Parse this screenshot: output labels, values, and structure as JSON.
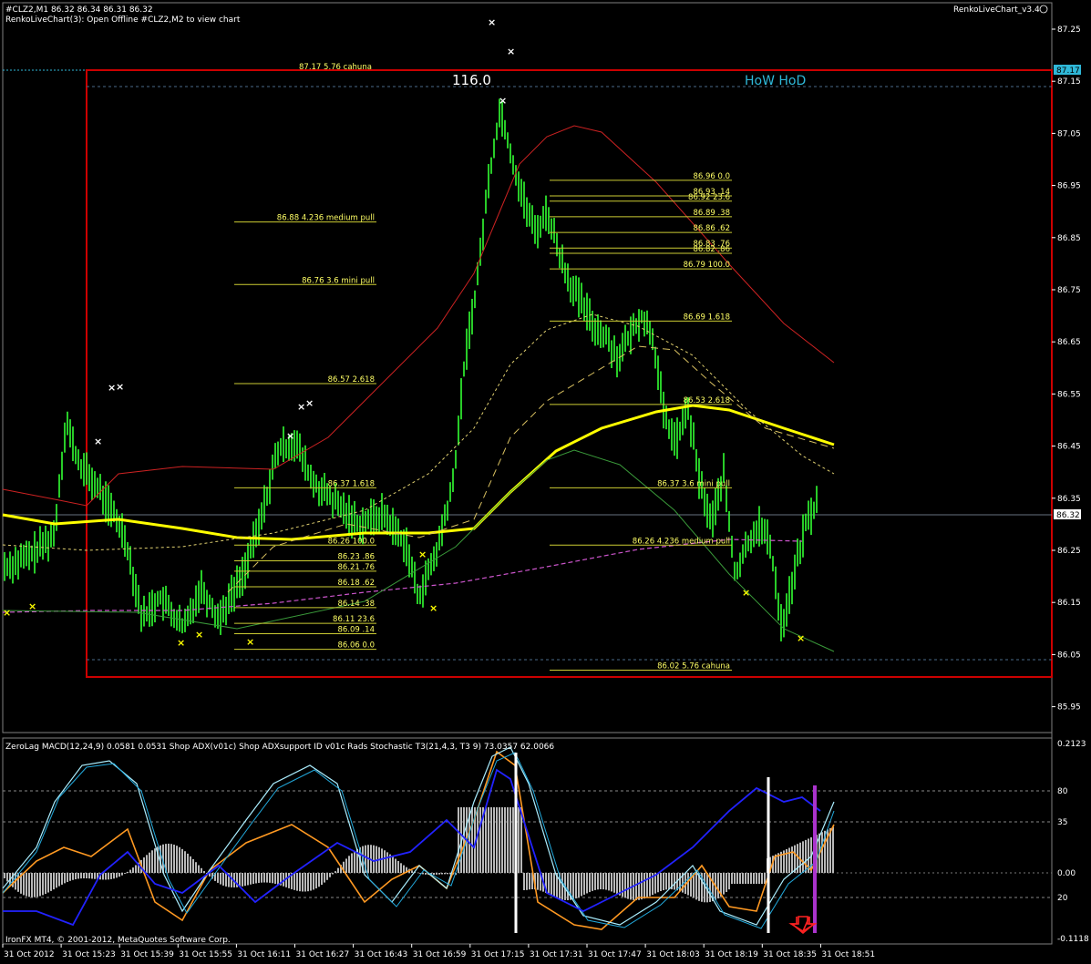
{
  "header": {
    "line1": "#CLZ2,M1  86.32 86.34 86.31 86.32",
    "line2": "RenkoLiveChart(3): Open Offline #CLZ2,M2 to view chart",
    "right_label": "RenkoLiveChart_v3.4"
  },
  "overlay": {
    "top_label": "116.0",
    "how_hod": "HoW HoD",
    "cahuna_top": "87.17  5.76  cahuna"
  },
  "price_axis": {
    "ticks": [
      "87.25",
      "87.15",
      "87.05",
      "86.95",
      "86.85",
      "86.75",
      "86.65",
      "86.55",
      "86.45",
      "86.35",
      "86.25",
      "86.15",
      "86.05",
      "85.95"
    ],
    "tick_values": [
      87.25,
      87.15,
      87.05,
      86.95,
      86.85,
      86.75,
      86.65,
      86.55,
      86.45,
      86.35,
      86.25,
      86.15,
      86.05,
      85.95
    ],
    "hod_badge": "87.17",
    "current_badge": "86.32"
  },
  "fib_labels": [
    {
      "text": "86.88  4.236 medium pull",
      "price": 86.88
    },
    {
      "text": "86.76  3.6   mini pull",
      "price": 86.76
    },
    {
      "text": "86.57  2.618",
      "price": 86.57
    },
    {
      "text": "86.37  1.618",
      "price": 86.37
    },
    {
      "text": "86.26  100.0",
      "price": 86.26
    },
    {
      "text": "86.23  .86",
      "price": 86.23
    },
    {
      "text": "86.21  .76",
      "price": 86.21
    },
    {
      "text": "86.18  .62",
      "price": 86.18
    },
    {
      "text": "86.14  .38",
      "price": 86.14
    },
    {
      "text": "86.11  23.6",
      "price": 86.11
    },
    {
      "text": "86.09  .14",
      "price": 86.09
    },
    {
      "text": "86.06  0.0",
      "price": 86.06
    },
    {
      "text": "86.96  0.0",
      "price": 86.96
    },
    {
      "text": "86.93  .14",
      "price": 86.93
    },
    {
      "text": "86.92  23.6",
      "price": 86.92
    },
    {
      "text": "86.89  .38",
      "price": 86.89
    },
    {
      "text": "86.86  .62",
      "price": 86.86
    },
    {
      "text": "86.83  .76",
      "price": 86.83
    },
    {
      "text": "86.82  .86",
      "price": 86.82
    },
    {
      "text": "86.79  100.0",
      "price": 86.79
    },
    {
      "text": "86.69  1.618",
      "price": 86.69
    },
    {
      "text": "86.53  2.618",
      "price": 86.53
    },
    {
      "text": "86.37  3.6   mini pull",
      "price": 86.37
    },
    {
      "text": "86.26  4.236 medium pull",
      "price": 86.26
    },
    {
      "text": "86.02  5.76  cahuna",
      "price": 86.02
    }
  ],
  "indicator": {
    "label": "ZeroLag MACD(12,24,9) 0.0581 0.0531  Shop ADX(v01c)  Shop ADXsupport ID v01c  Rads Stochastic T3(21,4,3, T3 9) 73.0357 62.0066",
    "axis_ticks": [
      "0.2123",
      "80",
      "35",
      "0.00",
      "20",
      "-0.1118"
    ],
    "copyright": "IronFX MT4, © 2001-2012, MetaQuotes Software Corp."
  },
  "time_axis": [
    "31 Oct 2012",
    "31 Oct 15:23",
    "31 Oct 15:39",
    "31 Oct 15:55",
    "31 Oct 16:11",
    "31 Oct 16:27",
    "31 Oct 16:43",
    "31 Oct 16:59",
    "31 Oct 17:15",
    "31 Oct 17:31",
    "31 Oct 17:47",
    "31 Oct 18:03",
    "31 Oct 18:19",
    "31 Oct 18:35",
    "31 Oct 18:51"
  ],
  "chart_data": {
    "type": "line",
    "title": "#CLZ2,M1  86.32 86.34 86.31 86.32",
    "xlabel": "",
    "ylabel": "",
    "ylim": [
      85.92,
      87.28
    ],
    "x": [
      "31 Oct 2012",
      "31 Oct 15:23",
      "31 Oct 15:39",
      "31 Oct 15:55",
      "31 Oct 16:11",
      "31 Oct 16:27",
      "31 Oct 16:43",
      "31 Oct 16:59",
      "31 Oct 17:15",
      "31 Oct 17:31",
      "31 Oct 17:47",
      "31 Oct 18:03",
      "31 Oct 18:19",
      "31 Oct 18:35",
      "31 Oct 18:51"
    ],
    "price_path": [
      [
        0,
        86.22
      ],
      [
        0.4,
        86.24
      ],
      [
        0.8,
        86.28
      ],
      [
        1.0,
        86.5
      ],
      [
        1.2,
        86.42
      ],
      [
        1.6,
        86.36
      ],
      [
        2.0,
        86.28
      ],
      [
        2.3,
        86.12
      ],
      [
        2.6,
        86.16
      ],
      [
        3.0,
        86.1
      ],
      [
        3.3,
        86.18
      ],
      [
        3.6,
        86.12
      ],
      [
        4.0,
        86.2
      ],
      [
        4.3,
        86.3
      ],
      [
        4.6,
        86.44
      ],
      [
        4.9,
        86.46
      ],
      [
        5.2,
        86.38
      ],
      [
        5.6,
        86.34
      ],
      [
        6.0,
        86.3
      ],
      [
        6.4,
        86.32
      ],
      [
        6.8,
        86.26
      ],
      [
        7.0,
        86.16
      ],
      [
        7.3,
        86.24
      ],
      [
        7.6,
        86.38
      ],
      [
        7.8,
        86.62
      ],
      [
        8.0,
        86.76
      ],
      [
        8.2,
        86.96
      ],
      [
        8.4,
        87.1
      ],
      [
        8.6,
        87.0
      ],
      [
        8.8,
        86.92
      ],
      [
        9.0,
        86.86
      ],
      [
        9.2,
        86.9
      ],
      [
        9.4,
        86.82
      ],
      [
        9.6,
        86.76
      ],
      [
        9.8,
        86.72
      ],
      [
        10.0,
        86.68
      ],
      [
        10.2,
        86.66
      ],
      [
        10.4,
        86.62
      ],
      [
        10.6,
        86.66
      ],
      [
        10.8,
        86.7
      ],
      [
        11.0,
        86.66
      ],
      [
        11.2,
        86.5
      ],
      [
        11.4,
        86.46
      ],
      [
        11.6,
        86.52
      ],
      [
        11.8,
        86.38
      ],
      [
        12.0,
        86.3
      ],
      [
        12.2,
        86.4
      ],
      [
        12.4,
        86.2
      ],
      [
        12.6,
        86.26
      ],
      [
        12.8,
        86.3
      ],
      [
        13.0,
        86.26
      ],
      [
        13.2,
        86.1
      ],
      [
        13.4,
        86.2
      ],
      [
        13.6,
        86.3
      ],
      [
        13.8,
        86.34
      ]
    ],
    "series": [
      {
        "name": "",
        "values": []
      }
    ],
    "grid": false,
    "legend": "none"
  },
  "colors": {
    "bars": "#33ff33",
    "yellow_ma": "#ffff00",
    "red_band": "#cc2222",
    "frame": "#cc0000",
    "cyan_text": "#2fb8d8",
    "magenta_ma": "#cc55cc",
    "macd_hist": "#b8b8b8",
    "orange": "#ff9922",
    "blue": "#2222ff"
  }
}
